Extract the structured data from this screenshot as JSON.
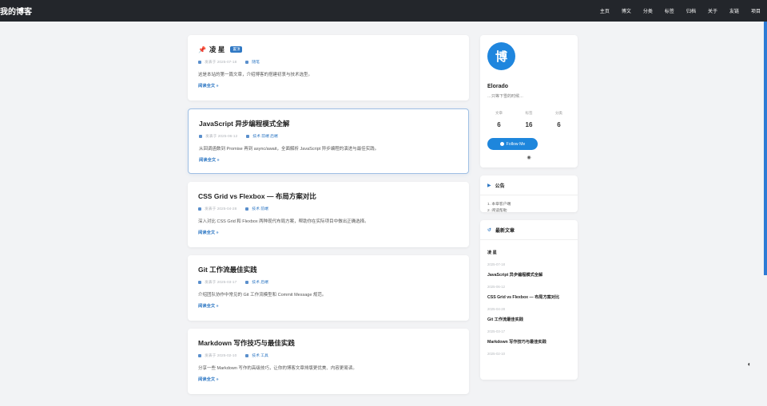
{
  "header": {
    "brand": "我的博客",
    "nav": [
      "主页",
      "博文",
      "分类",
      "标签",
      "归档",
      "关于",
      "友链",
      "项目"
    ]
  },
  "posts": [
    {
      "title": "凌 星",
      "pinned": true,
      "badge": "置顶",
      "date": "发表于 2025-07-18",
      "categories": "随笔",
      "excerpt": "这是本站的第一篇文章，介绍博客的搭建初衷与技术选型。",
      "read_more": "阅读全文 »"
    },
    {
      "title": "JavaScript 异步编程模式全解",
      "pinned": false,
      "date": "发表于 2025-06-12",
      "categories": "技术 前端 后端",
      "excerpt": "从回调函数到 Promise 再到 async/await，全面解析 JavaScript 异步编程的演进与最佳实践。",
      "read_more": "阅读全文 »"
    },
    {
      "title": "CSS Grid vs Flexbox — 布局方案对比",
      "pinned": false,
      "date": "发表于 2025-04-28",
      "categories": "技术 前端",
      "excerpt": "深入对比 CSS Grid 和 Flexbox 两种现代布局方案，帮助你在实际项目中做出正确选择。",
      "read_more": "阅读全文 »"
    },
    {
      "title": "Git 工作流最佳实践",
      "pinned": false,
      "date": "发表于 2025-03-17",
      "categories": "技术 后端",
      "excerpt": "介绍团队协作中常见的 Git 工作流模型和 Commit Message 规范。",
      "read_more": "阅读全文 »"
    },
    {
      "title": "Markdown 写作技巧与最佳实践",
      "pinned": false,
      "date": "发表于 2025-02-10",
      "categories": "技术 工具",
      "excerpt": "分享一些 Markdown 写作的高级技巧，让你的博客文章排版更优美、内容更易读。",
      "read_more": "阅读全文 »"
    }
  ],
  "profile": {
    "avatar_char": "博",
    "name": "Elorado",
    "desc": "…只等下雪的时候…",
    "stats": [
      {
        "label": "文章",
        "value": "6"
      },
      {
        "label": "标签",
        "value": "16"
      },
      {
        "label": "分类",
        "value": "6"
      }
    ],
    "follow": "Follow Me",
    "github_icon": "github-icon"
  },
  "notice": {
    "title": "公告",
    "items": [
      "1. 本章客户端",
      "2. 阅读帮助"
    ]
  },
  "recent": {
    "title": "最新文章",
    "items": [
      {
        "title": "凌 星",
        "date": "2025-07-18"
      },
      {
        "title": "JavaScript 异步编程模式全解",
        "date": "2025-06-12"
      },
      {
        "title": "CSS Grid vs Flexbox — 布局方案对比",
        "date": "2025-04-28"
      },
      {
        "title": "Git 工作流最佳实践",
        "date": "2025-03-17"
      },
      {
        "title": "Markdown 写作技巧与最佳实践",
        "date": "2025-02-10"
      }
    ]
  },
  "colors": {
    "accent": "#2f78c4",
    "topbar": "#23262b",
    "avatar": "#1f86de"
  }
}
